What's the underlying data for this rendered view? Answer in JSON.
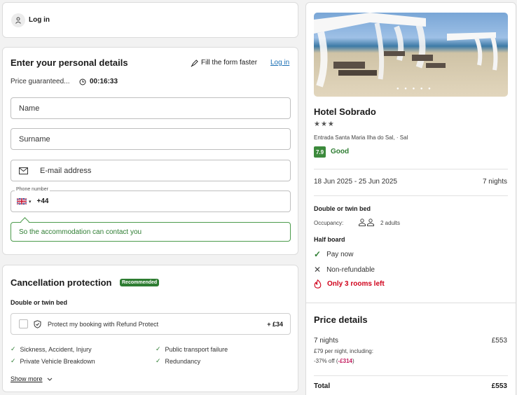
{
  "login_bar": {
    "label": "Log in"
  },
  "personal": {
    "title": "Enter your personal details",
    "fill_faster": "Fill the form faster",
    "login_link": "Log in",
    "price_guaranteed": "Price guaranteed...",
    "timer": "00:16:33",
    "name_placeholder": "Name",
    "surname_placeholder": "Surname",
    "email_placeholder": "E-mail address",
    "phone_label": "Phone number",
    "phone_prefix": "+44",
    "contact_note": "So the accommodation can contact you"
  },
  "cancellation": {
    "title": "Cancellation protection",
    "badge": "Recommended",
    "room": "Double or twin bed",
    "protect_label": "Protect my booking with Refund Protect",
    "protect_price": "+ £34",
    "features": [
      "Sickness, Accident, Injury",
      "Public transport failure",
      "Private Vehicle Breakdown",
      "Redundancy"
    ],
    "show_more": "Show more"
  },
  "hotel": {
    "name": "Hotel Sobrado",
    "stars": "★★★",
    "address": "Entrada Santa Maria Ilha do Sal, · Sal",
    "rating": "7.9",
    "rating_label": "Good",
    "dates": "18 Jun 2025 - 25 Jun 2025",
    "nights": "7 nights",
    "room": "Double or twin bed",
    "occupancy_label": "Occupancy:",
    "occupancy": "2 adults",
    "board": "Half board",
    "pay_now": "Pay now",
    "non_refundable": "Non-refundable",
    "rooms_left": "Only 3 rooms left"
  },
  "price": {
    "title": "Price details",
    "nights": "7 nights",
    "amount": "£553",
    "per_night": "£79 per night, including:",
    "discount_prefix": "-37% off (",
    "discount_value": "-£314",
    "discount_suffix": ")",
    "total_label": "Total",
    "total": "£553"
  },
  "colors": {
    "accent_green": "#2e7d32",
    "brand_green": "#3c8a3c",
    "link_blue": "#1a6fb5",
    "alert_red": "#d0021b",
    "discount_pink": "#c2185b"
  }
}
